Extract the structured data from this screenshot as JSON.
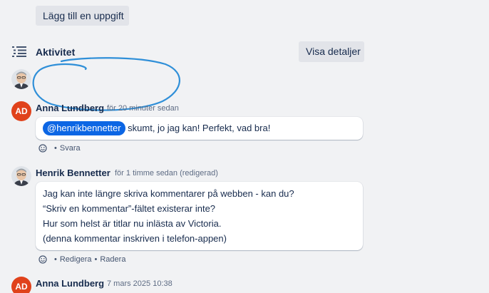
{
  "buttons": {
    "add_task": "Lägg till en uppgift",
    "show_details": "Visa detaljer"
  },
  "activity": {
    "title": "Aktivitet"
  },
  "comments": [
    {
      "author": "Anna Lundberg",
      "initials": "AD",
      "time": "för 20 minuter sedan",
      "mention": "@henrikbennetter",
      "text": " skumt, jo jag kan! Perfekt, vad bra!",
      "actions": [
        "Svara"
      ]
    },
    {
      "author": "Henrik Bennetter",
      "time": "för 1 timme sedan (redigerad)",
      "lines": [
        "Jag kan inte längre skriva kommentarer på webben - kan du?",
        "“Skriv en kommentar”-fältet existerar inte?",
        "Hur som helst är titlar nu inlästa av Victoria.",
        "(denna kommentar inskriven i telefon-appen)"
      ],
      "actions": [
        "Redigera",
        "Radera"
      ]
    },
    {
      "author": "Anna Lundberg",
      "initials": "AD",
      "time": "7 mars 2025 10:38"
    }
  ],
  "colors": {
    "background": "#f1f2f4",
    "mention": "#0c66e4",
    "avatar_initials_bg": "#e0421b",
    "scribble": "#2f8fd8"
  }
}
